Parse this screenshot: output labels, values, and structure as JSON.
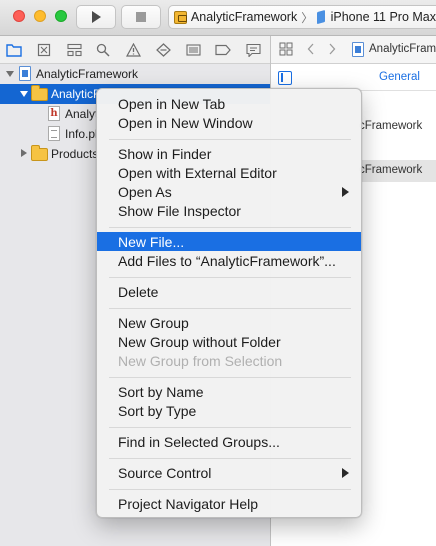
{
  "toolbar": {
    "run_icon": "play-icon",
    "stop_icon": "stop-icon",
    "scheme_name": "AnalyticFramework",
    "separator": "〉",
    "device_name": "iPhone 11 Pro Max"
  },
  "navigator": {
    "filter_icons": [
      "folder-icon",
      "source-control-icon",
      "symbol-icon",
      "find-icon",
      "issue-icon",
      "test-icon",
      "debug-icon",
      "breakpoint-icon",
      "report-icon"
    ],
    "tree": [
      {
        "label": "AnalyticFramework",
        "type": "project"
      },
      {
        "label": "AnalyticF",
        "type": "group"
      },
      {
        "label": "Analyt",
        "type": "header"
      },
      {
        "label": "Info.pl",
        "type": "plist"
      },
      {
        "label": "Products",
        "type": "group"
      }
    ]
  },
  "editor": {
    "breadcrumb": "AnalyticFram",
    "tab_general": "General",
    "project_text": "cFramework",
    "target_text": "cFramework"
  },
  "context_menu": {
    "items": [
      "Open in New Tab",
      "Open in New Window",
      "Show in Finder",
      "Open with External Editor",
      "Open As",
      "Show File Inspector",
      "New File...",
      "Add Files to “AnalyticFramework”...",
      "Delete",
      "New Group",
      "New Group without Folder",
      "New Group from Selection",
      "Sort by Name",
      "Sort by Type",
      "Find in Selected Groups...",
      "Source Control",
      "Project Navigator Help"
    ],
    "highlighted": "New File...",
    "disabled": [
      "New Group from Selection"
    ]
  },
  "colors": {
    "selection": "#1466d2",
    "menu_highlight": "#1a6fe3"
  }
}
